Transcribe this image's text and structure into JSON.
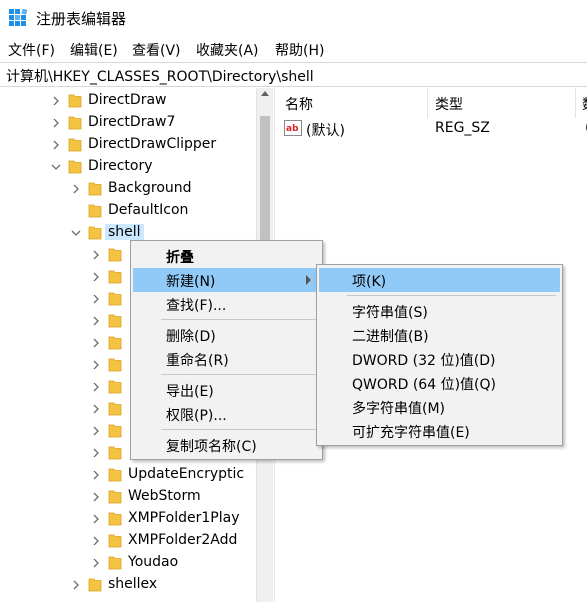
{
  "window": {
    "title": "注册表编辑器",
    "app_icon": "regedit-icon"
  },
  "menubar": {
    "items": [
      {
        "label": "文件(F)"
      },
      {
        "label": "编辑(E)"
      },
      {
        "label": "查看(V)"
      },
      {
        "label": "收藏夹(A)"
      },
      {
        "label": "帮助(H)"
      }
    ]
  },
  "address": {
    "path": "计算机\\HKEY_CLASSES_ROOT\\Directory\\shell"
  },
  "tree": {
    "nodes": [
      {
        "label": "DirectDraw",
        "expander": "collapsed"
      },
      {
        "label": "DirectDraw7",
        "expander": "collapsed"
      },
      {
        "label": "DirectDrawClipper",
        "expander": "collapsed"
      },
      {
        "label": "Directory",
        "expander": "expanded"
      },
      {
        "label": "Background",
        "expander": "collapsed"
      },
      {
        "label": "DefaultIcon",
        "expander": "none"
      },
      {
        "label": "shell",
        "expander": "expanded",
        "selected": true
      },
      {
        "label": "",
        "expander": "collapsed"
      },
      {
        "label": "",
        "expander": "collapsed"
      },
      {
        "label": "",
        "expander": "collapsed"
      },
      {
        "label": "",
        "expander": "collapsed"
      },
      {
        "label": "",
        "expander": "collapsed"
      },
      {
        "label": "",
        "expander": "collapsed"
      },
      {
        "label": "",
        "expander": "collapsed"
      },
      {
        "label": "",
        "expander": "collapsed"
      },
      {
        "label": "",
        "expander": "collapsed"
      },
      {
        "label": "",
        "expander": "collapsed"
      },
      {
        "label": "UpdateEncryptic",
        "expander": "collapsed"
      },
      {
        "label": "WebStorm",
        "expander": "collapsed"
      },
      {
        "label": "XMPFolder1Play",
        "expander": "collapsed"
      },
      {
        "label": "XMPFolder2Add",
        "expander": "collapsed"
      },
      {
        "label": "Youdao",
        "expander": "collapsed"
      },
      {
        "label": "shellex",
        "expander": "collapsed"
      }
    ]
  },
  "list": {
    "columns": [
      {
        "label": "名称"
      },
      {
        "label": "类型"
      },
      {
        "label": "数"
      }
    ],
    "rows": [
      {
        "name": "(默认)",
        "type": "REG_SZ",
        "data": "("
      }
    ]
  },
  "context_menu": {
    "items": [
      {
        "label": "折叠",
        "bold": true
      },
      {
        "label": "新建(N)",
        "submenu": true,
        "highlighted": true
      },
      {
        "label": "查找(F)..."
      },
      {
        "label": "删除(D)"
      },
      {
        "label": "重命名(R)"
      },
      {
        "label": "导出(E)"
      },
      {
        "label": "权限(P)..."
      },
      {
        "label": "复制项名称(C)"
      }
    ]
  },
  "submenu": {
    "items": [
      {
        "label": "项(K)",
        "highlighted": true
      },
      {
        "label": "字符串值(S)"
      },
      {
        "label": "二进制值(B)"
      },
      {
        "label": "DWORD (32 位)值(D)"
      },
      {
        "label": "QWORD (64 位)值(Q)"
      },
      {
        "label": "多字符串值(M)"
      },
      {
        "label": "可扩充字符串值(E)"
      }
    ]
  },
  "colors": {
    "selection": "#cce8ff",
    "menu_highlight": "#91c9f7",
    "menu_background": "#f2f2f2",
    "folder": "#f5c342"
  }
}
